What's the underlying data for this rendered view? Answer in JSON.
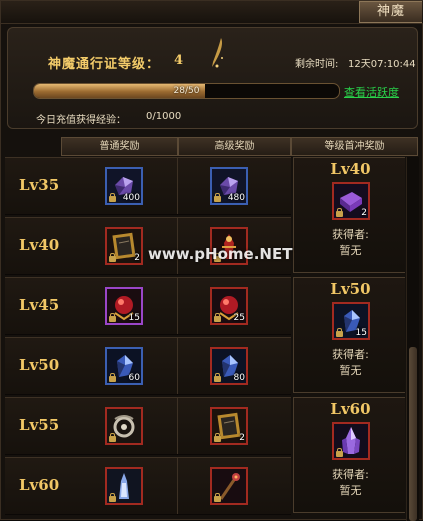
{
  "top_tab": {
    "label": "神魔"
  },
  "pass": {
    "title": "神魔通行证等级：",
    "level": "4",
    "remaining_label": "剩余时间:",
    "remaining_value": "12天07:10:44",
    "progress_text": "28/50",
    "progress_fraction": 0.56,
    "activity_link": "查看活跃度",
    "exp_label": "今日充值获得经验：",
    "exp_value": "0/1000"
  },
  "columns": {
    "normal": "普通奖励",
    "advanced": "高级奖励",
    "first": "等级首冲奖励"
  },
  "rows": [
    {
      "level": "Lv35",
      "normal": {
        "icon": "purple-gem-icon",
        "count": "400",
        "frame": "blue"
      },
      "advanced": {
        "icon": "purple-gem-icon",
        "count": "480",
        "frame": "blue"
      }
    },
    {
      "level": "Lv40",
      "normal": {
        "icon": "scroll-book-icon",
        "count": "2",
        "frame": "red"
      },
      "advanced": {
        "icon": "red-figure-icon",
        "count": "",
        "frame": "red"
      }
    },
    {
      "level": "Lv45",
      "normal": {
        "icon": "red-orb-icon",
        "count": "15",
        "frame": "purple"
      },
      "advanced": {
        "icon": "red-orb-icon",
        "count": "25",
        "frame": "red"
      }
    },
    {
      "level": "Lv50",
      "normal": {
        "icon": "blue-crystal-icon",
        "count": "60",
        "frame": "blue"
      },
      "advanced": {
        "icon": "blue-crystal-icon",
        "count": "80",
        "frame": "red"
      }
    },
    {
      "level": "Lv55",
      "normal": {
        "icon": "silver-ornament-icon",
        "count": "",
        "frame": "red"
      },
      "advanced": {
        "icon": "scroll-book-icon",
        "count": "2",
        "frame": "red"
      }
    },
    {
      "level": "Lv60",
      "normal": {
        "icon": "blue-figure-icon",
        "count": "",
        "frame": "red"
      },
      "advanced": {
        "icon": "staff-icon",
        "count": "",
        "frame": "red"
      }
    }
  ],
  "bonus": [
    {
      "level": "Lv40",
      "icon": "purple-book-icon",
      "count": "2",
      "winner_label": "获得者:",
      "winner": "暂无"
    },
    {
      "level": "Lv50",
      "icon": "blue-crystal-icon",
      "count": "15",
      "winner_label": "获得者:",
      "winner": "暂无"
    },
    {
      "level": "Lv60",
      "icon": "purple-crystal-icon",
      "count": "",
      "winner_label": "获得者:",
      "winner": "暂无"
    }
  ],
  "watermark": "www.pHome.NET",
  "colors": {
    "gold": "#f1c766",
    "link_green": "#29d24a",
    "frame_red": "#a22a20",
    "frame_blue": "#3b5fb2",
    "frame_purple": "#9a46c8"
  }
}
